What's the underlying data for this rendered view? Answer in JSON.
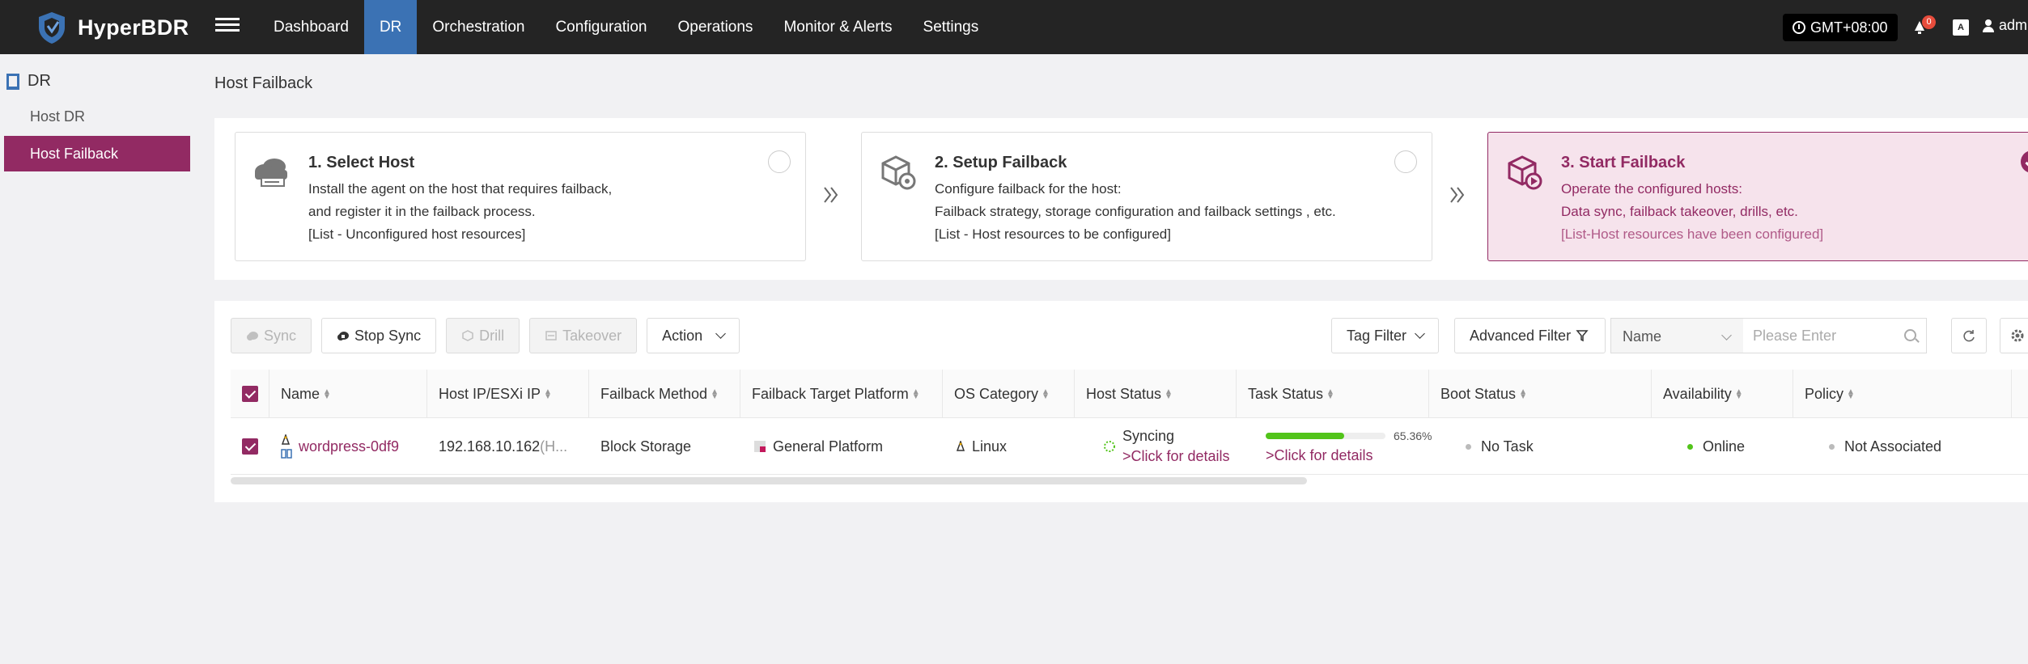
{
  "app": {
    "name": "HyperBDR"
  },
  "nav": {
    "items": [
      {
        "label": "Dashboard"
      },
      {
        "label": "DR"
      },
      {
        "label": "Orchestration"
      },
      {
        "label": "Configuration"
      },
      {
        "label": "Operations"
      },
      {
        "label": "Monitor & Alerts"
      },
      {
        "label": "Settings"
      }
    ],
    "active": "DR"
  },
  "header": {
    "timezone": "GMT+08:00",
    "alert_count": "0",
    "lang_icon": "A",
    "user": "adm"
  },
  "sidebar": {
    "group": "DR",
    "items": [
      {
        "label": "Host DR"
      },
      {
        "label": "Host Failback"
      }
    ]
  },
  "page": {
    "title": "Host Failback"
  },
  "steps": [
    {
      "title": "1. Select Host",
      "line1": "Install the agent on the host that requires failback,",
      "line2": "and register it in the failback process.",
      "link": "[List - Unconfigured host resources]"
    },
    {
      "title": "2. Setup Failback",
      "line1": "Configure failback for the host:",
      "line2": "Failback strategy, storage configuration and failback settings , etc.",
      "link": "[List - Host resources to be configured]"
    },
    {
      "title": "3. Start Failback",
      "line1": "Operate the configured hosts:",
      "line2": "Data sync, failback takeover, drills, etc.",
      "link": "[List-Host resources have been configured]"
    }
  ],
  "toolbar": {
    "sync": "Sync",
    "stop_sync": "Stop Sync",
    "drill": "Drill",
    "takeover": "Takeover",
    "action": "Action",
    "tag_filter": "Tag Filter",
    "advanced_filter": "Advanced Filter",
    "search_field": "Name",
    "search_placeholder": "Please Enter"
  },
  "table": {
    "columns": [
      "Name",
      "Host IP/ESXi IP",
      "Failback Method",
      "Failback Target Platform",
      "OS Category",
      "Host Status",
      "Task Status",
      "Boot Status",
      "Availability",
      "Policy"
    ],
    "rows": [
      {
        "name": "wordpress-0df9",
        "ip": "192.168.10.162",
        "ip_suffix": "(H...",
        "method": "Block Storage",
        "platform": "General Platform",
        "os": "Linux",
        "host_status": "Syncing",
        "host_status_link": ">Click for details",
        "task_progress": 65.36,
        "task_progress_label": "65.36%",
        "task_link": ">Click for details",
        "boot_status": "No Task",
        "availability": "Online",
        "policy": "Not Associated"
      }
    ]
  },
  "colors": {
    "accent": "#922a63",
    "nav_active": "#3b72b4",
    "topbar": "#242424",
    "progress": "#52c41a",
    "online": "#52c41a"
  }
}
